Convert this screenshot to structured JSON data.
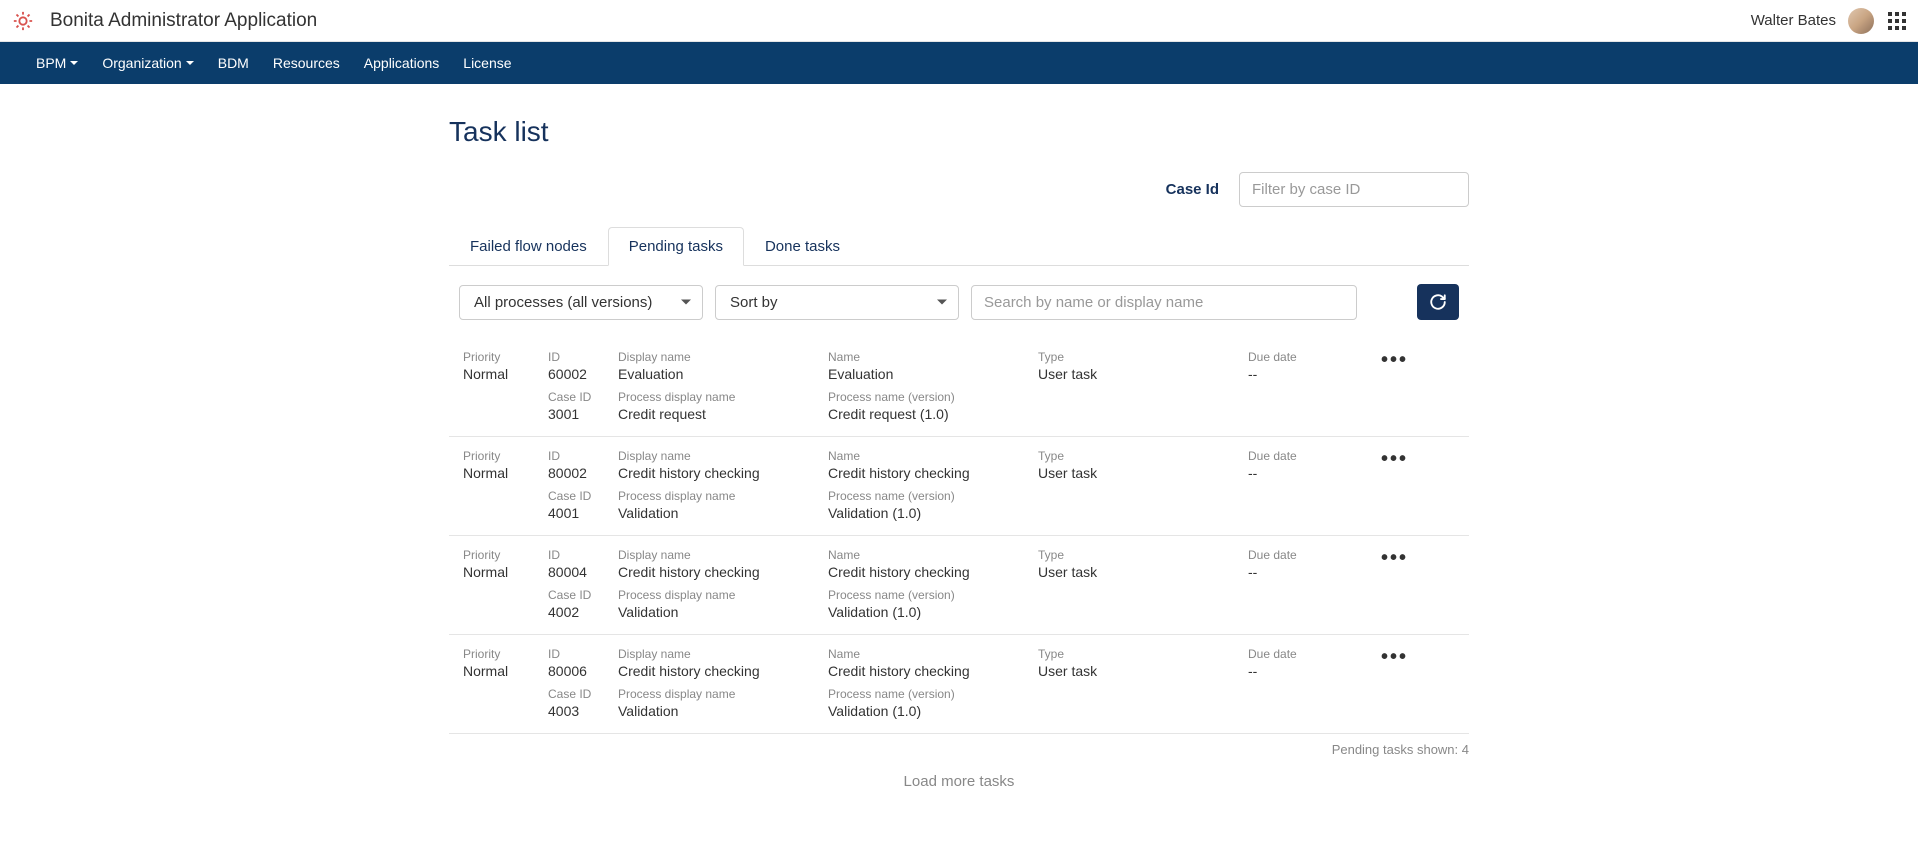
{
  "header": {
    "app_title": "Bonita Administrator Application",
    "username": "Walter Bates"
  },
  "nav": {
    "items": [
      "BPM",
      "Organization",
      "BDM",
      "Resources",
      "Applications",
      "License"
    ],
    "dropdown_flags": [
      true,
      true,
      false,
      false,
      false,
      false
    ]
  },
  "page": {
    "title": "Task list",
    "case_id_label": "Case Id",
    "case_id_placeholder": "Filter by case ID"
  },
  "tabs": {
    "items": [
      "Failed flow nodes",
      "Pending tasks",
      "Done tasks"
    ],
    "active_index": 1
  },
  "toolbar": {
    "process_filter": "All processes (all versions)",
    "sort_by": "Sort by",
    "search_placeholder": "Search by name or display name"
  },
  "labels": {
    "priority": "Priority",
    "id": "ID",
    "display_name": "Display name",
    "name": "Name",
    "type": "Type",
    "due_date": "Due date",
    "case_id": "Case ID",
    "process_display_name": "Process display name",
    "process_name_version": "Process name (version)"
  },
  "tasks": [
    {
      "priority": "Normal",
      "id": "60002",
      "display_name": "Evaluation",
      "name": "Evaluation",
      "type": "User task",
      "due_date": "--",
      "case_id": "3001",
      "process_display_name": "Credit request",
      "process_name_version": "Credit request (1.0)"
    },
    {
      "priority": "Normal",
      "id": "80002",
      "display_name": "Credit history checking",
      "name": "Credit history checking",
      "type": "User task",
      "due_date": "--",
      "case_id": "4001",
      "process_display_name": "Validation",
      "process_name_version": "Validation (1.0)"
    },
    {
      "priority": "Normal",
      "id": "80004",
      "display_name": "Credit history checking",
      "name": "Credit history checking",
      "type": "User task",
      "due_date": "--",
      "case_id": "4002",
      "process_display_name": "Validation",
      "process_name_version": "Validation (1.0)"
    },
    {
      "priority": "Normal",
      "id": "80006",
      "display_name": "Credit history checking",
      "name": "Credit history checking",
      "type": "User task",
      "due_date": "--",
      "case_id": "4003",
      "process_display_name": "Validation",
      "process_name_version": "Validation (1.0)"
    }
  ],
  "footer": {
    "shown_text": "Pending tasks shown: 4",
    "load_more": "Load more tasks"
  }
}
